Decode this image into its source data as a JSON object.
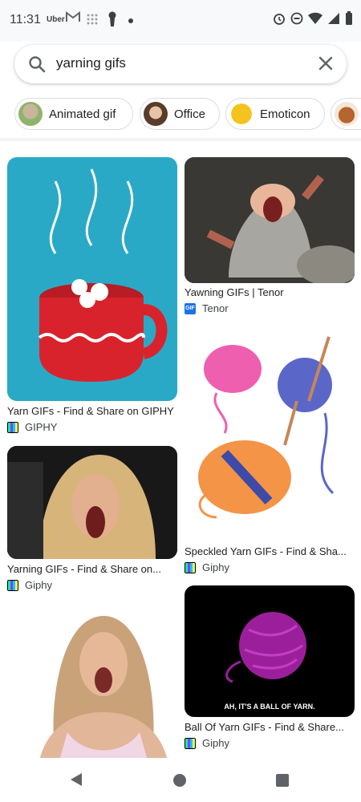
{
  "status_bar": {
    "time": "11:31",
    "uber_label": "Uber"
  },
  "search": {
    "query": "yarning gifs"
  },
  "chips": [
    {
      "label": "Animated gif"
    },
    {
      "label": "Office"
    },
    {
      "label": "Emoticon"
    }
  ],
  "results": {
    "r1": {
      "title": "Yarn GIFs - Find & Share on GIPHY",
      "source": "GIPHY"
    },
    "r2": {
      "title": "Yawning GIFs | Tenor",
      "source": "Tenor"
    },
    "r3": {
      "title": "Speckled Yarn GIFs - Find & Sha...",
      "source": "Giphy"
    },
    "r4": {
      "title": "Yarning GIFs - Find & Share on...",
      "source": "Giphy"
    },
    "r5": {
      "title": "Ball Of Yarn GIFs - Find & Share...",
      "source": "Giphy",
      "caption": "AH, IT'S A BALL OF YARN."
    }
  },
  "favicon_labels": {
    "tenor": "GIF"
  }
}
